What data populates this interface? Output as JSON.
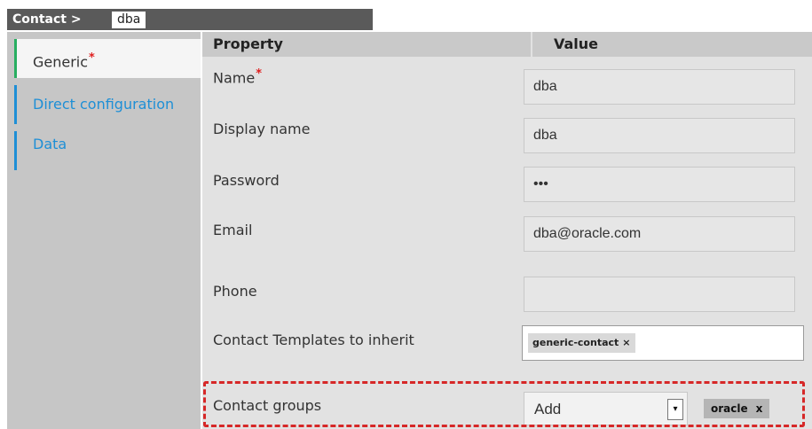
{
  "breadcrumb": {
    "section": "Contact >",
    "current": "dba"
  },
  "sidebar": {
    "items": [
      {
        "label": "Generic",
        "required": "*"
      },
      {
        "label": "Direct configuration"
      },
      {
        "label": "Data"
      }
    ]
  },
  "table": {
    "headers": {
      "property": "Property",
      "value": "Value"
    },
    "rows": [
      {
        "label": "Name",
        "required": "*",
        "value": "dba"
      },
      {
        "label": "Display name",
        "value": "dba"
      },
      {
        "label": "Password",
        "value": "•••"
      },
      {
        "label": "Email",
        "value": "dba@oracle.com"
      },
      {
        "label": "Phone",
        "value": ""
      },
      {
        "label": "Contact Templates to inherit",
        "tag": "generic-contact",
        "tag_remove": "×"
      },
      {
        "label": "Contact groups",
        "select": "Add",
        "select_arrow": "▾",
        "tag": "oracle",
        "tag_remove": "x"
      }
    ]
  },
  "colors": {
    "generic_accent": "#27ae60",
    "link_accent": "#1e8fd6",
    "highlight_border": "#d62828"
  }
}
